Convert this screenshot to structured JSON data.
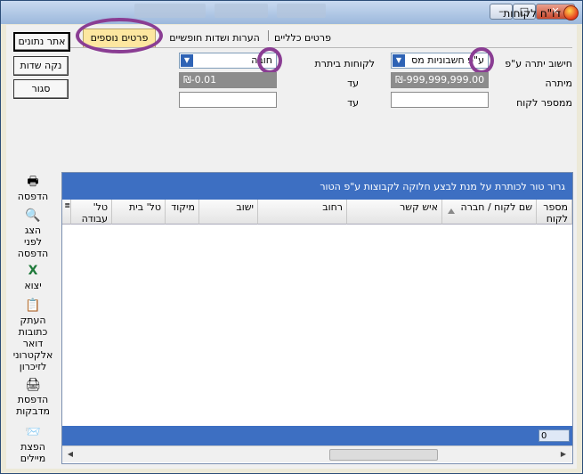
{
  "window": {
    "title": "דו\"ח לקוחות"
  },
  "titlebar_buttons": {
    "minimize": "–",
    "maximize": "□",
    "close": "✕"
  },
  "tabs": [
    {
      "label": "פרטים כלליים"
    },
    {
      "label": "הערות ושדות חופשיים"
    },
    {
      "label": "פרטים נוספים"
    }
  ],
  "side_buttons": {
    "fetch": "אתר נתונים",
    "clear": "נקה שדות",
    "close": "סגור"
  },
  "filters": {
    "calc_label": "חישוב יתרה ע\"פ",
    "calc_value": "ע\"פ חשבוניות מס",
    "balance_clients_label": "לקוחות ביתרת",
    "balance_clients_value": "חובה",
    "from_balance_label": "מיתרה",
    "from_balance_value": "₪-999,999,999.00",
    "to_label_1": "עד",
    "to_balance_value": "₪-0.01",
    "from_client_label": "ממספר לקוח",
    "from_client_value": "",
    "to_label_2": "עד",
    "to_client_value": ""
  },
  "grid": {
    "group_hint": "גרור טור לכותרת על מנת לבצע חלוקה לקבוצות ע\"פ הטור",
    "columns": [
      {
        "label": "מספר לקוח"
      },
      {
        "label": "שם לקוח / חברה"
      },
      {
        "label": "איש קשר"
      },
      {
        "label": "רחוב"
      },
      {
        "label": "ישוב"
      },
      {
        "label": "מיקוד"
      },
      {
        "label": "טל' בית"
      },
      {
        "label": "טל' עבודה"
      }
    ],
    "count": "0"
  },
  "toolbar": [
    {
      "label": "הדפסה",
      "icon": "printer-icon"
    },
    {
      "label": "הצג לפני הדפסה",
      "icon": "preview-icon"
    },
    {
      "label": "יצוא",
      "icon": "excel-icon"
    },
    {
      "label": "העתק כתובות דואר אלקטרוני לזיכרון",
      "icon": "copy-email-icon"
    },
    {
      "label": "הדפסת מדבקות",
      "icon": "label-printer-icon"
    },
    {
      "label": "הפצת מיילים",
      "icon": "mail-send-icon"
    }
  ]
}
